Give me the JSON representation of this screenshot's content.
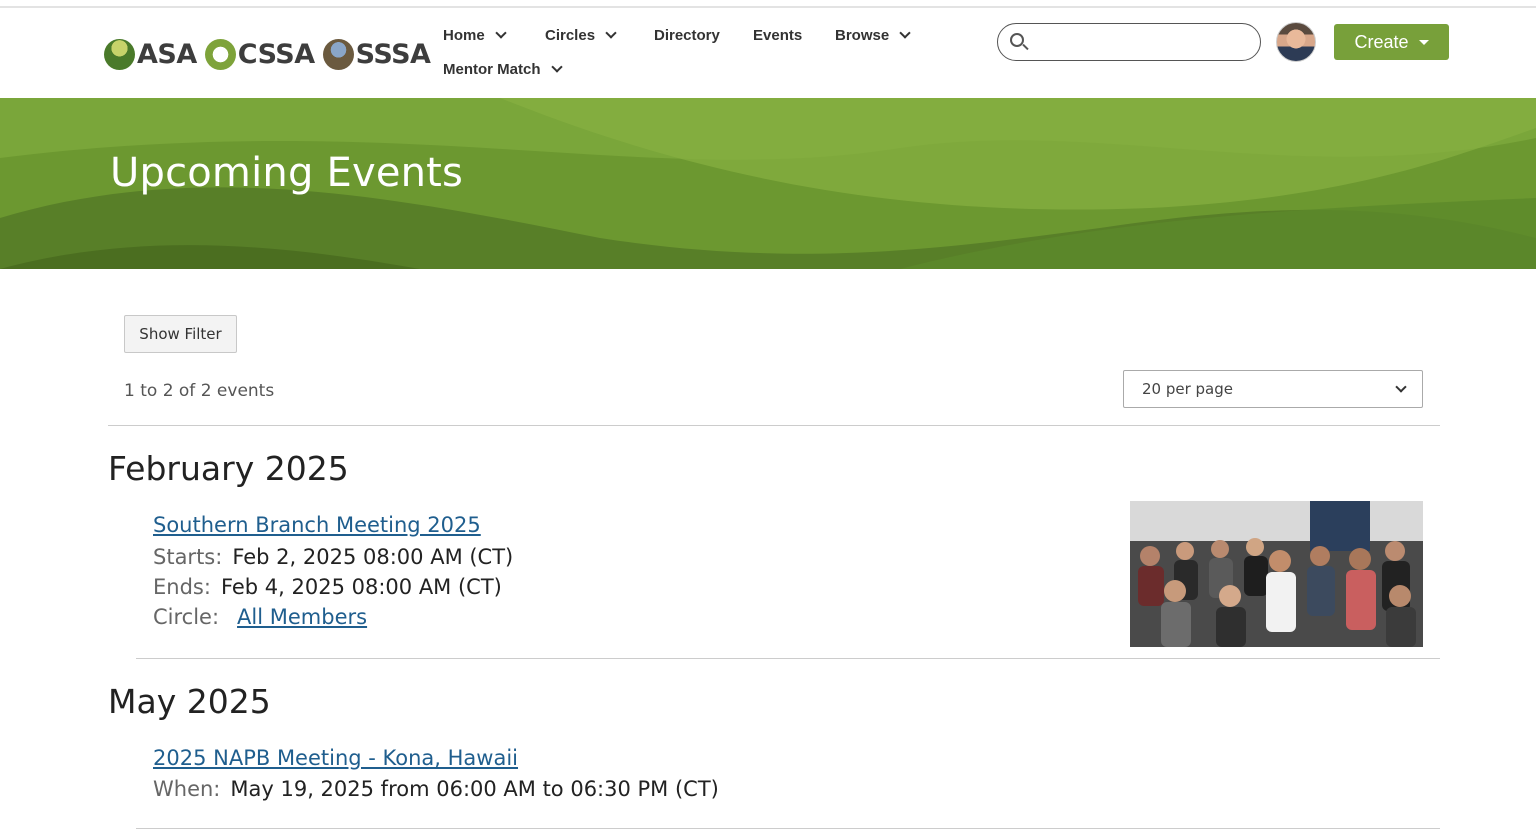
{
  "header": {
    "logo": {
      "orgs": [
        "ASA",
        "CSSA",
        "SSSA"
      ]
    },
    "nav": [
      {
        "label": "Home",
        "dropdown": true
      },
      {
        "label": "Circles",
        "dropdown": true
      },
      {
        "label": "Directory",
        "dropdown": false
      },
      {
        "label": "Events",
        "dropdown": false
      },
      {
        "label": "Browse",
        "dropdown": true
      },
      {
        "label": "Mentor Match",
        "dropdown": true
      }
    ],
    "search": {
      "value": "",
      "placeholder": ""
    },
    "create_label": "Create"
  },
  "banner": {
    "title": "Upcoming Events"
  },
  "controls": {
    "filter_label": "Show Filter",
    "count_text": "1 to 2 of 2 events",
    "per_page": "20 per page"
  },
  "groups": [
    {
      "month": "February 2025",
      "events": [
        {
          "title": "Southern Branch Meeting 2025",
          "starts_label": "Starts:",
          "starts": "Feb 2, 2025 08:00 AM (CT)",
          "ends_label": "Ends:",
          "ends": "Feb 4, 2025 08:00 AM (CT)",
          "circle_label": "Circle:",
          "circle": "All Members"
        }
      ]
    },
    {
      "month": "May 2025",
      "events": [
        {
          "title": "2025 NAPB Meeting - Kona, Hawaii",
          "when_label": "When:",
          "when": "May 19, 2025 from 06:00 AM to 06:30 PM (CT)"
        }
      ]
    }
  ],
  "colors": {
    "brand_green": "#78a03a",
    "link_blue": "#1f5e8e",
    "banner_green": "#6e9a32"
  },
  "icons": {
    "search": "search-icon",
    "dropdown": "chevron-down-icon",
    "create_caret": "caret-down-icon"
  }
}
